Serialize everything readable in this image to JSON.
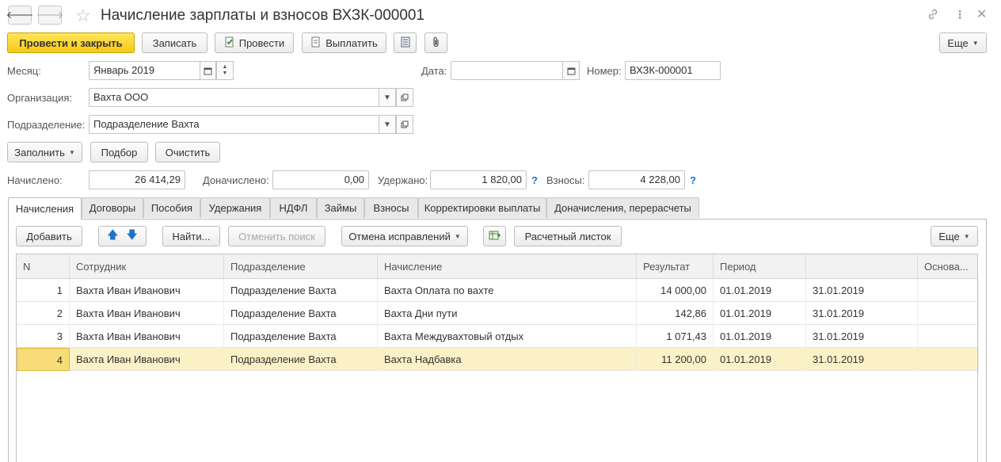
{
  "window": {
    "title": "Начисление зарплаты и взносов ВХЗК-000001",
    "link_icon": "link-icon",
    "menu_icon": "more-vertical-icon",
    "close_icon": "close-icon"
  },
  "toolbar": {
    "post_close": "Провести и закрыть",
    "save": "Записать",
    "post": "Провести",
    "pay": "Выплатить",
    "more": "Еще"
  },
  "header": {
    "month_label": "Месяц:",
    "month_value": "Январь 2019",
    "date_label": "Дата:",
    "date_value": "",
    "number_label": "Номер:",
    "number_value": "ВХЗК-000001",
    "org_label": "Организация:",
    "org_value": "Вахта ООО",
    "dept_label": "Подразделение:",
    "dept_value": "Подразделение Вахта"
  },
  "actions": {
    "fill": "Заполнить",
    "select": "Подбор",
    "clear": "Очистить"
  },
  "totals": {
    "accrued_label": "Начислено:",
    "accrued_value": "26 414,29",
    "additional_label": "Доначислено:",
    "additional_value": "0,00",
    "withheld_label": "Удержано:",
    "withheld_value": "1 820,00",
    "contrib_label": "Взносы:",
    "contrib_value": "4 228,00",
    "help": "?"
  },
  "tabs": [
    "Начисления",
    "Договоры",
    "Пособия",
    "Удержания",
    "НДФЛ",
    "Займы",
    "Взносы",
    "Корректировки выплаты",
    "Доначисления, перерасчеты"
  ],
  "table_toolbar": {
    "add": "Добавить",
    "find": "Найти...",
    "cancel_search": "Отменить поиск",
    "cancel_corrections": "Отмена исправлений",
    "payslip": "Расчетный листок",
    "more": "Еще"
  },
  "table": {
    "columns": [
      "N",
      "Сотрудник",
      "Подразделение",
      "Начисление",
      "Результат",
      "Период",
      "",
      "Основа..."
    ],
    "rows": [
      {
        "n": "1",
        "employee": "Вахта Иван Иванович",
        "dept": "Подразделение Вахта",
        "accrual": "Вахта Оплата по вахте",
        "result": "14 000,00",
        "from": "01.01.2019",
        "to": "31.01.2019",
        "basis": ""
      },
      {
        "n": "2",
        "employee": "Вахта Иван Иванович",
        "dept": "Подразделение Вахта",
        "accrual": "Вахта Дни пути",
        "result": "142,86",
        "from": "01.01.2019",
        "to": "31.01.2019",
        "basis": ""
      },
      {
        "n": "3",
        "employee": "Вахта Иван Иванович",
        "dept": "Подразделение Вахта",
        "accrual": "Вахта Междувахтовый отдых",
        "result": "1 071,43",
        "from": "01.01.2019",
        "to": "31.01.2019",
        "basis": ""
      },
      {
        "n": "4",
        "employee": "Вахта Иван Иванович",
        "dept": "Подразделение Вахта",
        "accrual": "Вахта Надбавка",
        "result": "11 200,00",
        "from": "01.01.2019",
        "to": "31.01.2019",
        "basis": ""
      }
    ],
    "selected_row": 4
  },
  "colors": {
    "primary_button": "#f5c916",
    "selected_row": "#fbf1c7",
    "help_mark": "#1d73c5"
  }
}
